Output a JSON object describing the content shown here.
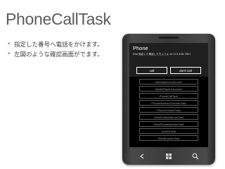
{
  "slide": {
    "title": "PhoneCallTask",
    "bullets": [
      "指定した番号へ電話をかけます。",
      "左図のような確認画面がでます。"
    ]
  },
  "phone": {
    "dialog": {
      "title": "Phone",
      "message": "Dial 指定した電話したちょうよ at 123-456-7891",
      "call_label": "call",
      "dont_call_label": "don't call"
    },
    "task_list": [
      "MarketplaceLauncher",
      "MediaPlayerLauncher",
      "PhoneCallTask",
      "PhoneNumberChooserTask",
      "PhotoChooserTask",
      "SaveEmailAddressTask",
      "SavePhoneNumberTask",
      "SearchTask",
      "WebBrowserTask"
    ],
    "hardware_buttons": [
      "back-icon",
      "windows-icon",
      "search-icon"
    ]
  },
  "colors": {
    "title": "#5b5b5b",
    "bullet_text": "#404040",
    "phone_body": "#3a3a3a",
    "screen": "#000000",
    "dialog_bg": "#1f1f1f",
    "list_text": "#9a9a9a"
  }
}
